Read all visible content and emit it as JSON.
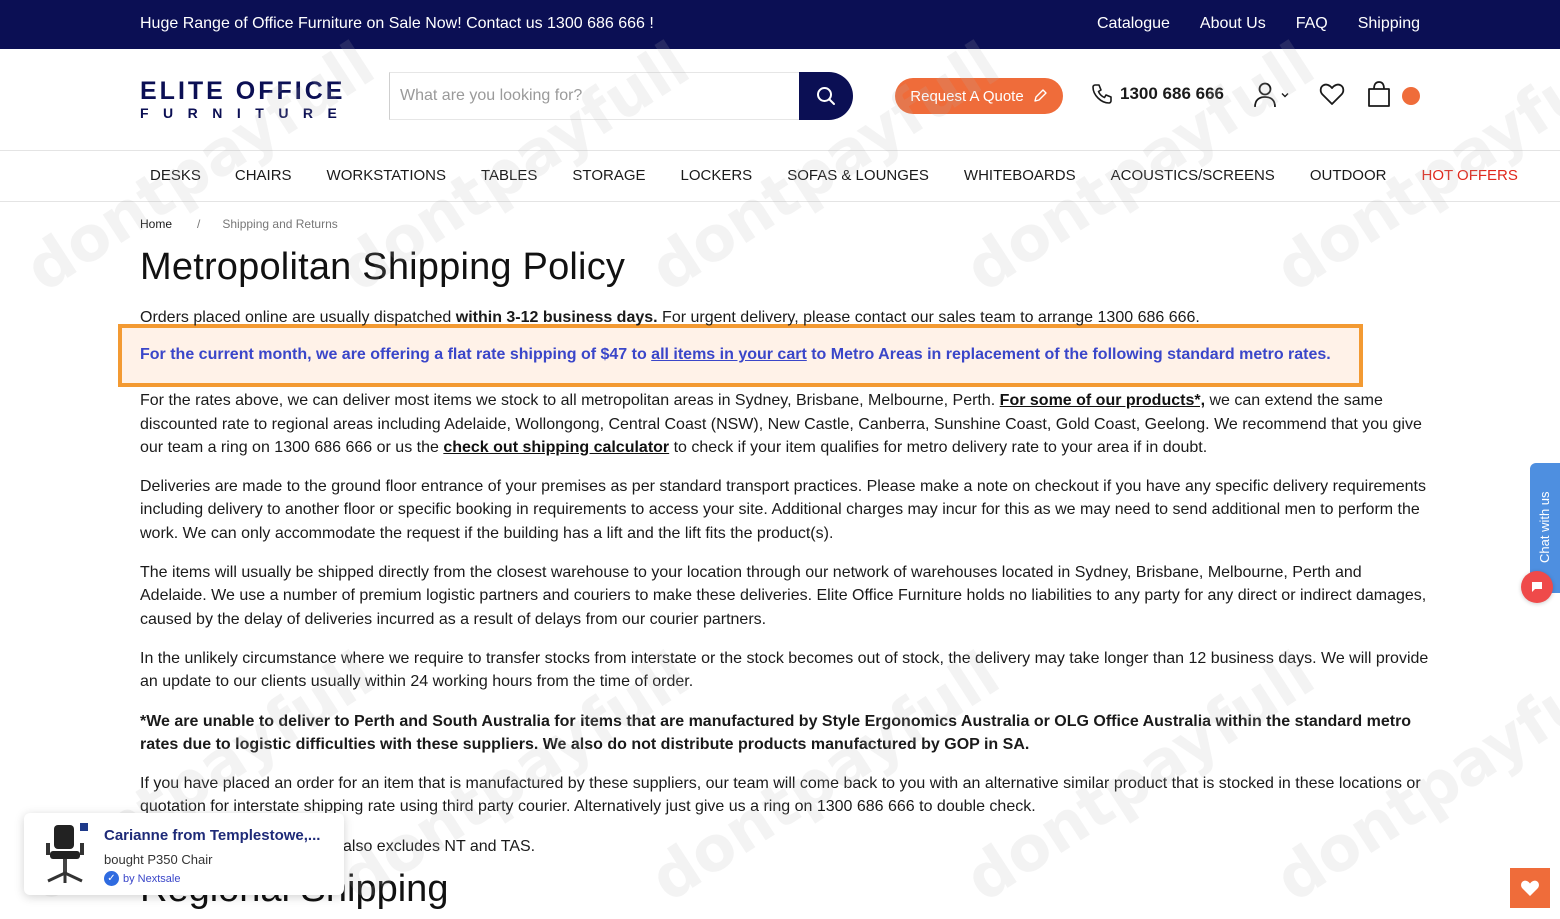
{
  "topbar": {
    "promo": "Huge Range of Office Furniture on Sale Now! Contact us 1300 686 666 !",
    "links": [
      "Catalogue",
      "About Us",
      "FAQ",
      "Shipping"
    ]
  },
  "header": {
    "logo_line1": "ELITE OFFICE",
    "logo_line2": "FURNITURE",
    "search_placeholder": "What are you looking for?",
    "quote_label": "Request A Quote",
    "phone": "1300 686 666"
  },
  "nav": {
    "items": [
      "DESKS",
      "CHAIRS",
      "WORKSTATIONS",
      "TABLES",
      "STORAGE",
      "LOCKERS",
      "SOFAS & LOUNGES",
      "WHITEBOARDS",
      "ACOUSTICS/SCREENS",
      "OUTDOOR",
      "HOT OFFERS"
    ]
  },
  "breadcrumb": {
    "home": "Home",
    "separator": "/",
    "current": "Shipping and Returns"
  },
  "page": {
    "title": "Metropolitan Shipping Policy",
    "p1_a": "Orders placed online are usually dispatched ",
    "p1_b": "within 3-12 business days.",
    "p1_c": " For urgent delivery, please contact our sales team to arrange 1300 686 666.",
    "highlight_a": "For the current month, we are offering a flat rate shipping of $47 to ",
    "highlight_link": "all items in your cart",
    "highlight_b": " to Metro Areas in replacement of the following standard metro rates.",
    "p2_a": "For the rates above, we can deliver most items we stock to all metropolitan areas in Sydney, Brisbane, Melbourne, Perth. ",
    "p2_link": "For some of our products*,",
    "p2_b": " we can extend the same discounted rate to regional areas including Adelaide, Wollongong, Central Coast (NSW), New Castle, Canberra, Sunshine Coast, Gold Coast, Geelong. We recommend that you give our team a ring on 1300 686 666 or us the ",
    "p2_link2": "check out shipping calculator",
    "p2_c": " to check if your item qualifies for metro delivery rate to your area if in doubt.",
    "p3": "Deliveries are made to the ground floor entrance of your premises as per standard transport practices. Please make a note on checkout if you have any specific delivery requirements including delivery to another floor or specific booking in requirements to access your site. Additional charges may incur for this as we may need to send additional men to perform the work. We can only accommodate the request if the building has a lift and the lift fits the product(s).",
    "p4": "The items will usually be shipped directly from the closest warehouse to your location through our network of warehouses located in Sydney, Brisbane, Melbourne, Perth and Adelaide. We use a number of premium logistic partners and couriers to make these deliveries. Elite Office Furniture holds no liabilities to any party for any direct or indirect damages, caused by the delay of deliveries incurred as a result of delays from our courier partners.",
    "p5": "In the unlikely circumstance where we require to transfer stocks from interstate or the stock becomes out of stock, the delivery may take longer than 12 business days. We will provide an update to our clients usually within 24 working hours from the time of order.",
    "p6": "*We are unable to deliver to Perth and South Australia for items that are manufactured by Style Ergonomics Australia or OLG Office Australia  within the standard metro rates due to logistic difficulties with these suppliers. We also do not distribute products manufactured by GOP in SA.",
    "p7": "If you have placed an order for an item that is manufactured by these suppliers, our team will come back to you with an alternative similar product that is stocked in these locations or quotation for interstate shipping rate using third party courier. Alternatively just give us a ring on 1300 686 666 to double check.",
    "p8": "also excludes NT and TAS.",
    "subtitle": "Regional Shipping"
  },
  "chat": {
    "label": "Chat with us"
  },
  "popup": {
    "who": "Carianne from Templestowe,...",
    "what": "bought P350 Chair",
    "by": "by Nextsale"
  },
  "watermark": "dontpayfull",
  "colors": {
    "navy": "#0b0f54",
    "accent_orange": "#ef6c3a",
    "highlight_border": "#f39a32",
    "highlight_text": "#3a46c9",
    "hot_offers": "#e0281c"
  }
}
